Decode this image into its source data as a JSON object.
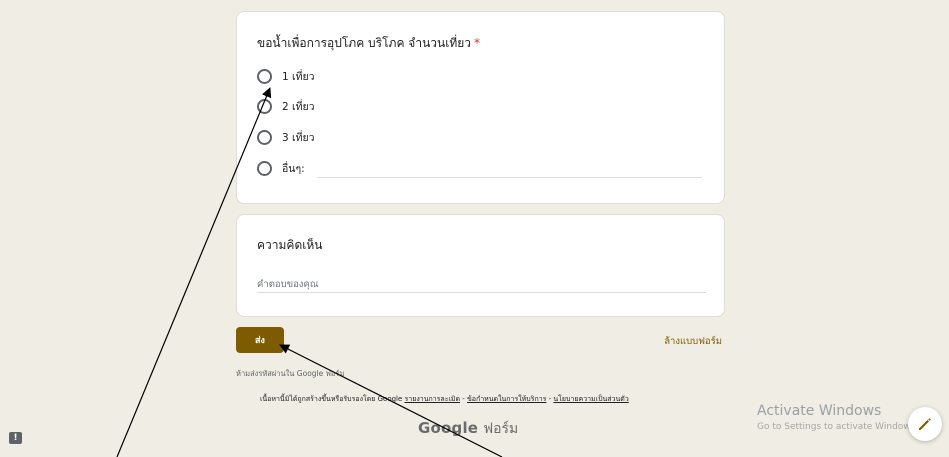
{
  "question": {
    "title": "ขอน้ำเพื่อการอุปโภค บริโภค จำนวนเที่ยว",
    "required_mark": "*",
    "options": [
      "1 เที่ยว",
      "2 เที่ยว",
      "3 เที่ยว",
      "อื่นๆ:"
    ]
  },
  "comment": {
    "title": "ความคิดเห็น",
    "placeholder": "คำตอบของคุณ"
  },
  "actions": {
    "submit_label": "ส่ง",
    "clear_label": "ล้างแบบฟอร์ม"
  },
  "footer": {
    "never_submit": "ห้ามส่งรหัสผ่านใน Google ฟอร์ม",
    "content_note": "เนื้อหานี้มิได้ถูกสร้างขึ้นหรือรับรองโดย Google",
    "link_abuse": "รายงานการละเมิด",
    "link_terms": "ข้อกำหนดในการให้บริการ",
    "link_privacy": "นโยบายความเป็นส่วนตัว",
    "separator": " - ",
    "brand_google": "Google",
    "brand_forms": "ฟอร์ม"
  },
  "windows": {
    "activate_title": "Activate Windows",
    "activate_sub": "Go to Settings to activate Windows."
  },
  "icons": {
    "feedback": "feedback-icon",
    "edit": "pencil-icon"
  },
  "colors": {
    "background": "#f0ede4",
    "accent": "#7d5c00",
    "required": "#d93025"
  }
}
